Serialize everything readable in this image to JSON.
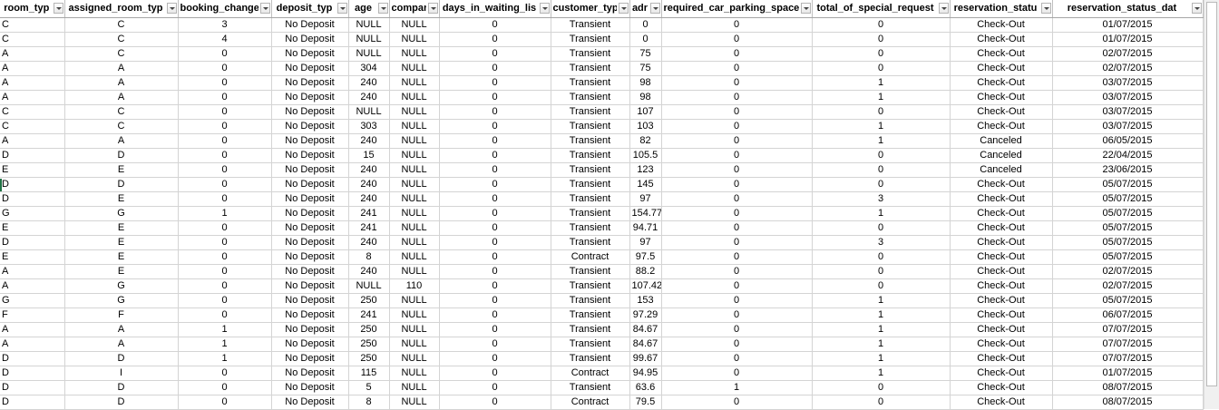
{
  "headers": [
    "room_typ",
    "assigned_room_typ",
    "booking_change",
    "deposit_typ",
    "age",
    "compar",
    "days_in_waiting_lis",
    "customer_typ",
    "adr",
    "required_car_parking_space",
    "total_of_special_request",
    "reservation_statu",
    "reservation_status_dat"
  ],
  "rows": [
    [
      "C",
      "C",
      "3",
      "No Deposit",
      "NULL",
      "NULL",
      "0",
      "Transient",
      "0",
      "0",
      "0",
      "Check-Out",
      "01/07/2015"
    ],
    [
      "C",
      "C",
      "4",
      "No Deposit",
      "NULL",
      "NULL",
      "0",
      "Transient",
      "0",
      "0",
      "0",
      "Check-Out",
      "01/07/2015"
    ],
    [
      "A",
      "C",
      "0",
      "No Deposit",
      "NULL",
      "NULL",
      "0",
      "Transient",
      "75",
      "0",
      "0",
      "Check-Out",
      "02/07/2015"
    ],
    [
      "A",
      "A",
      "0",
      "No Deposit",
      "304",
      "NULL",
      "0",
      "Transient",
      "75",
      "0",
      "0",
      "Check-Out",
      "02/07/2015"
    ],
    [
      "A",
      "A",
      "0",
      "No Deposit",
      "240",
      "NULL",
      "0",
      "Transient",
      "98",
      "0",
      "1",
      "Check-Out",
      "03/07/2015"
    ],
    [
      "A",
      "A",
      "0",
      "No Deposit",
      "240",
      "NULL",
      "0",
      "Transient",
      "98",
      "0",
      "1",
      "Check-Out",
      "03/07/2015"
    ],
    [
      "C",
      "C",
      "0",
      "No Deposit",
      "NULL",
      "NULL",
      "0",
      "Transient",
      "107",
      "0",
      "0",
      "Check-Out",
      "03/07/2015"
    ],
    [
      "C",
      "C",
      "0",
      "No Deposit",
      "303",
      "NULL",
      "0",
      "Transient",
      "103",
      "0",
      "1",
      "Check-Out",
      "03/07/2015"
    ],
    [
      "A",
      "A",
      "0",
      "No Deposit",
      "240",
      "NULL",
      "0",
      "Transient",
      "82",
      "0",
      "1",
      "Canceled",
      "06/05/2015"
    ],
    [
      "D",
      "D",
      "0",
      "No Deposit",
      "15",
      "NULL",
      "0",
      "Transient",
      "105.5",
      "0",
      "0",
      "Canceled",
      "22/04/2015"
    ],
    [
      "E",
      "E",
      "0",
      "No Deposit",
      "240",
      "NULL",
      "0",
      "Transient",
      "123",
      "0",
      "0",
      "Canceled",
      "23/06/2015"
    ],
    [
      "D",
      "D",
      "0",
      "No Deposit",
      "240",
      "NULL",
      "0",
      "Transient",
      "145",
      "0",
      "0",
      "Check-Out",
      "05/07/2015"
    ],
    [
      "D",
      "E",
      "0",
      "No Deposit",
      "240",
      "NULL",
      "0",
      "Transient",
      "97",
      "0",
      "3",
      "Check-Out",
      "05/07/2015"
    ],
    [
      "G",
      "G",
      "1",
      "No Deposit",
      "241",
      "NULL",
      "0",
      "Transient",
      "154.77",
      "0",
      "1",
      "Check-Out",
      "05/07/2015"
    ],
    [
      "E",
      "E",
      "0",
      "No Deposit",
      "241",
      "NULL",
      "0",
      "Transient",
      "94.71",
      "0",
      "0",
      "Check-Out",
      "05/07/2015"
    ],
    [
      "D",
      "E",
      "0",
      "No Deposit",
      "240",
      "NULL",
      "0",
      "Transient",
      "97",
      "0",
      "3",
      "Check-Out",
      "05/07/2015"
    ],
    [
      "E",
      "E",
      "0",
      "No Deposit",
      "8",
      "NULL",
      "0",
      "Contract",
      "97.5",
      "0",
      "0",
      "Check-Out",
      "05/07/2015"
    ],
    [
      "A",
      "E",
      "0",
      "No Deposit",
      "240",
      "NULL",
      "0",
      "Transient",
      "88.2",
      "0",
      "0",
      "Check-Out",
      "02/07/2015"
    ],
    [
      "A",
      "G",
      "0",
      "No Deposit",
      "NULL",
      "110",
      "0",
      "Transient",
      "107.42",
      "0",
      "0",
      "Check-Out",
      "02/07/2015"
    ],
    [
      "G",
      "G",
      "0",
      "No Deposit",
      "250",
      "NULL",
      "0",
      "Transient",
      "153",
      "0",
      "1",
      "Check-Out",
      "05/07/2015"
    ],
    [
      "F",
      "F",
      "0",
      "No Deposit",
      "241",
      "NULL",
      "0",
      "Transient",
      "97.29",
      "0",
      "1",
      "Check-Out",
      "06/07/2015"
    ],
    [
      "A",
      "A",
      "1",
      "No Deposit",
      "250",
      "NULL",
      "0",
      "Transient",
      "84.67",
      "0",
      "1",
      "Check-Out",
      "07/07/2015"
    ],
    [
      "A",
      "A",
      "1",
      "No Deposit",
      "250",
      "NULL",
      "0",
      "Transient",
      "84.67",
      "0",
      "1",
      "Check-Out",
      "07/07/2015"
    ],
    [
      "D",
      "D",
      "1",
      "No Deposit",
      "250",
      "NULL",
      "0",
      "Transient",
      "99.67",
      "0",
      "1",
      "Check-Out",
      "07/07/2015"
    ],
    [
      "D",
      "I",
      "0",
      "No Deposit",
      "115",
      "NULL",
      "0",
      "Contract",
      "94.95",
      "0",
      "1",
      "Check-Out",
      "01/07/2015"
    ],
    [
      "D",
      "D",
      "0",
      "No Deposit",
      "5",
      "NULL",
      "0",
      "Transient",
      "63.6",
      "1",
      "0",
      "Check-Out",
      "08/07/2015"
    ],
    [
      "D",
      "D",
      "0",
      "No Deposit",
      "8",
      "NULL",
      "0",
      "Contract",
      "79.5",
      "0",
      "0",
      "Check-Out",
      "08/07/2015"
    ]
  ],
  "colors": {
    "grid_line": "#d4d4d4",
    "selection_marker": "#217346"
  }
}
